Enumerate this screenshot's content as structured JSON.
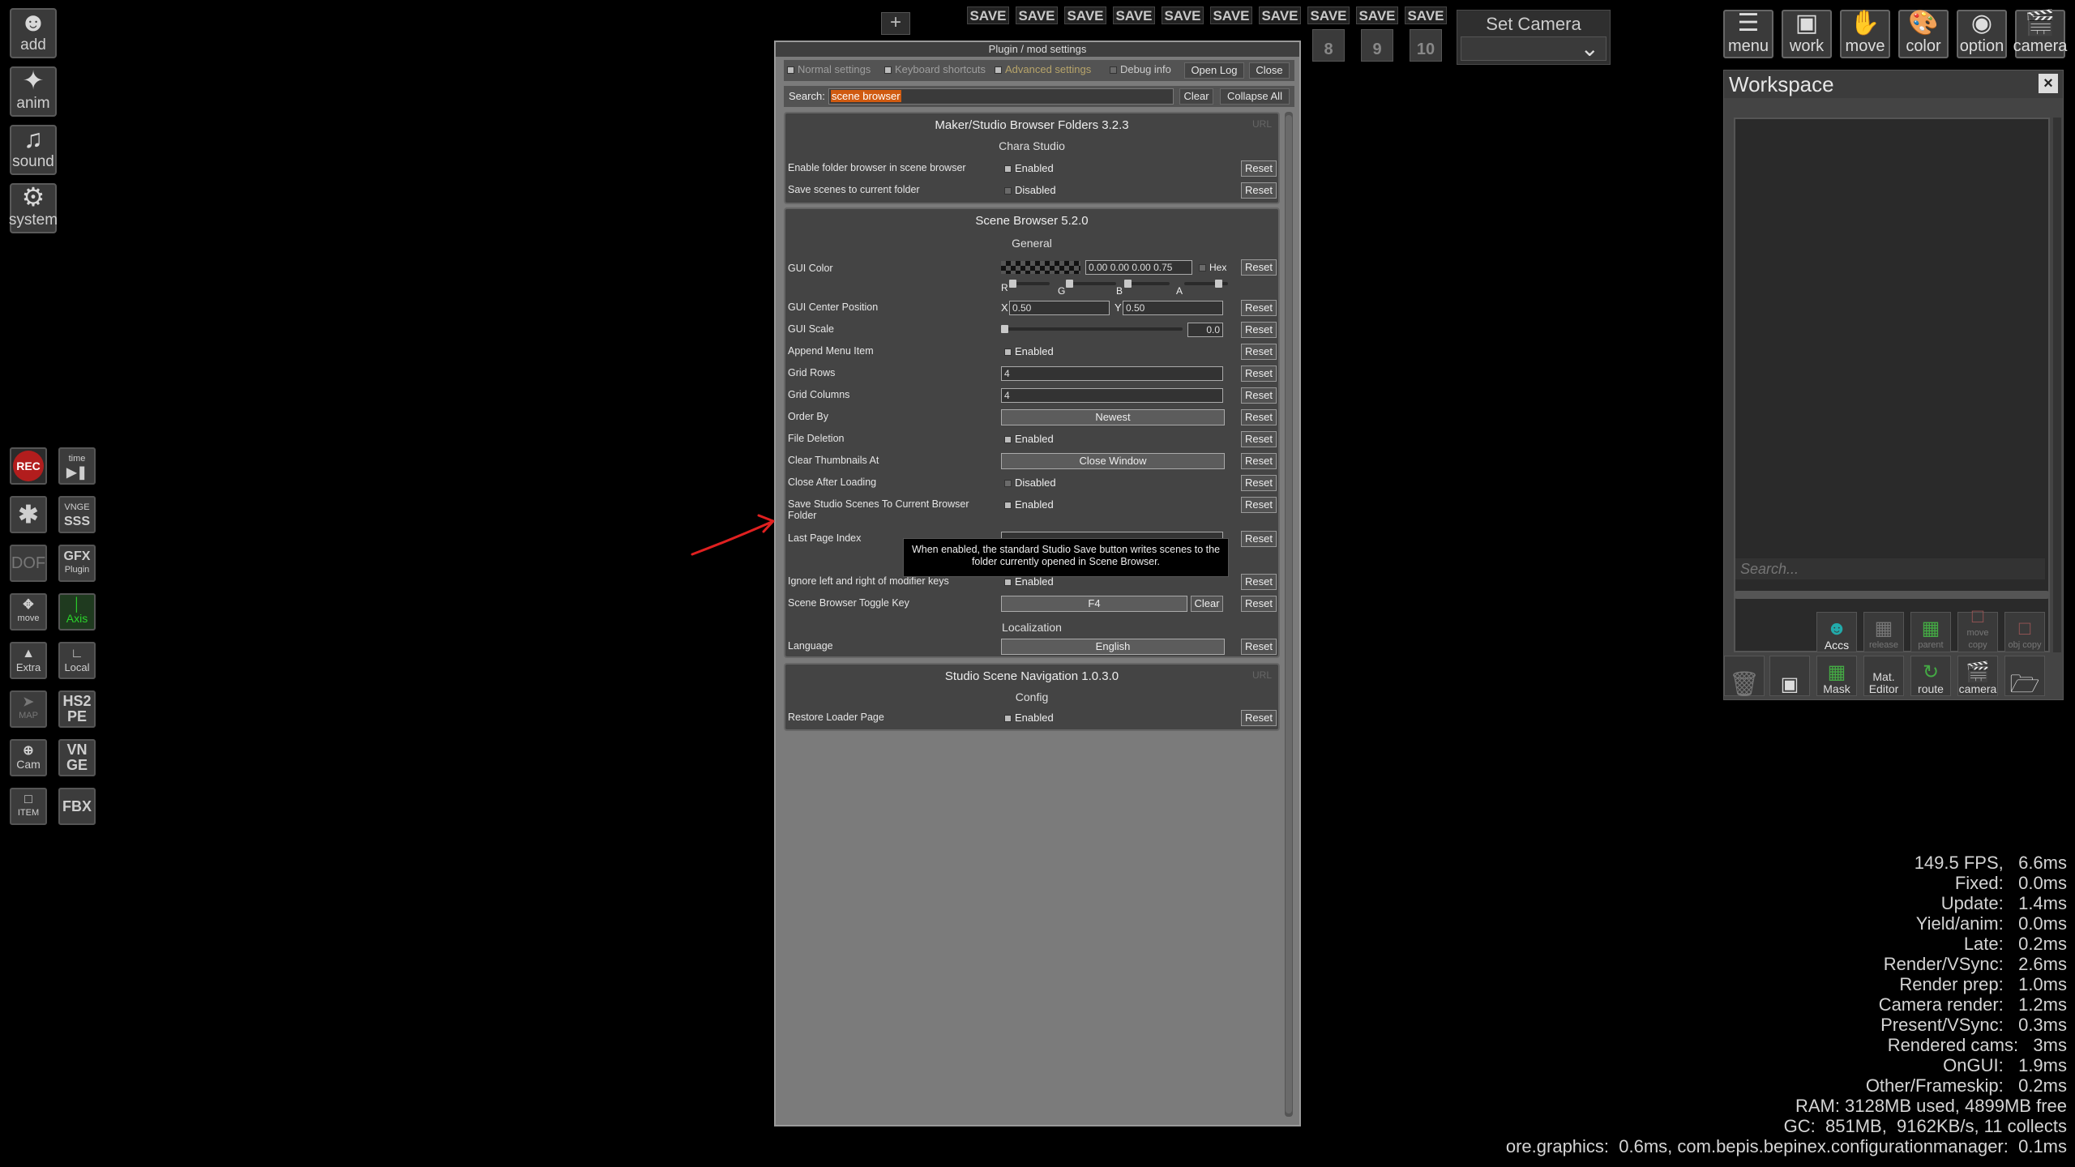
{
  "left_toolbar": [
    {
      "name": "add",
      "label": "add",
      "icon": "person-icon"
    },
    {
      "name": "anim",
      "label": "anim",
      "icon": "running-figure-icon"
    },
    {
      "name": "sound",
      "label": "sound",
      "icon": "music-note-icon"
    },
    {
      "name": "system",
      "label": "system",
      "icon": "gears-icon"
    }
  ],
  "left_small": {
    "rec": "REC",
    "time": "time",
    "sss_top": "VNGE",
    "sss": "SSS",
    "dof": "DOF",
    "gfx": "GFX",
    "gfx_sub": "Plugin",
    "move": "move",
    "axis": "Axis",
    "extra": "Extra",
    "local": "Local",
    "map": "MAP",
    "hs2pe": "HS2 PE",
    "cam": "Cam",
    "vnge": "VN GE",
    "item": "ITEM",
    "fbx": "FBX"
  },
  "save_bar": {
    "plus": "+",
    "slots": [
      {
        "label": "SAVE",
        "num": ""
      },
      {
        "label": "SAVE",
        "num": ""
      },
      {
        "label": "SAVE",
        "num": ""
      },
      {
        "label": "SAVE",
        "num": ""
      },
      {
        "label": "SAVE",
        "num": ""
      },
      {
        "label": "SAVE",
        "num": ""
      },
      {
        "label": "SAVE",
        "num": ""
      },
      {
        "label": "SAVE",
        "num": "8"
      },
      {
        "label": "SAVE",
        "num": "9"
      },
      {
        "label": "SAVE",
        "num": "10"
      }
    ],
    "set_camera": "Set Camera"
  },
  "right_menu": [
    {
      "label": "menu",
      "icon": "list-icon"
    },
    {
      "label": "work",
      "icon": "window-icon"
    },
    {
      "label": "move",
      "icon": "hand-icon"
    },
    {
      "label": "color",
      "icon": "palette-icon"
    },
    {
      "label": "option",
      "icon": "eye-icon"
    },
    {
      "label": "camera",
      "icon": "clapperboard-icon"
    }
  ],
  "workspace": {
    "title": "Workspace",
    "close": "×",
    "search_placeholder": "Search...",
    "buttons_row1": [
      "Accs",
      "release",
      "parent",
      "move copy",
      "obj copy"
    ],
    "buttons_row2": [
      "",
      "",
      "Mask",
      "Mat. Editor",
      "route",
      "camera",
      ""
    ]
  },
  "dialog": {
    "title": "Plugin / mod settings",
    "toolbar": {
      "normal": "Normal settings",
      "shortcuts": "Keyboard shortcuts",
      "advanced": "Advanced settings",
      "debug": "Debug info",
      "open_log": "Open Log",
      "close": "Close"
    },
    "search": {
      "label": "Search:",
      "value": "scene browser",
      "clear": "Clear",
      "collapse": "Collapse All"
    },
    "reset_label": "Reset",
    "sections": {
      "s1": {
        "title": "Maker/Studio Browser Folders 3.2.3",
        "url": "URL",
        "category": "Chara Studio",
        "rows": [
          {
            "name": "Enable folder browser in scene browser",
            "value": "Enabled",
            "checked": true
          },
          {
            "name": "Save scenes to current folder",
            "value": "Disabled",
            "checked": false
          }
        ]
      },
      "s2": {
        "title": "Scene Browser 5.2.0",
        "category": "General",
        "gui_color": {
          "name": "GUI Color",
          "value": "0.00 0.00 0.00 0.75",
          "hex": "Hex",
          "channels": [
            "R",
            "G",
            "B",
            "A"
          ]
        },
        "gui_center": {
          "name": "GUI Center Position",
          "x_label": "X",
          "x": "0.50",
          "y_label": "Y",
          "y": "0.50"
        },
        "gui_scale": {
          "name": "GUI Scale",
          "value": "0.0"
        },
        "append_menu": {
          "name": "Append Menu Item",
          "value": "Enabled"
        },
        "grid_rows": {
          "name": "Grid Rows",
          "value": "4"
        },
        "grid_columns": {
          "name": "Grid Columns",
          "value": "4"
        },
        "order_by": {
          "name": "Order By",
          "value": "Newest"
        },
        "file_deletion": {
          "name": "File Deletion",
          "value": "Enabled"
        },
        "clear_thumbs": {
          "name": "Clear Thumbnails At",
          "value": "Close Window"
        },
        "close_after": {
          "name": "Close After Loading",
          "value": "Disabled"
        },
        "save_studio": {
          "name": "Save Studio Scenes To Current Browser Folder",
          "value": "Enabled"
        },
        "last_page": {
          "name": "Last Page Index"
        },
        "ignore_lr": {
          "name": "Ignore left and right of modifier keys",
          "value": "Enabled"
        },
        "toggle_key": {
          "name": "Scene Browser Toggle Key",
          "value": "F4",
          "clear": "Clear"
        },
        "localization": "Localization",
        "language": {
          "name": "Language",
          "value": "English"
        }
      },
      "s3": {
        "title": "Studio Scene Navigation 1.0.3.0",
        "url": "URL",
        "category": "Config",
        "restore": {
          "name": "Restore Loader Page",
          "value": "Enabled"
        }
      }
    },
    "tooltip": "When enabled, the standard Studio Save button writes scenes to the folder currently opened in Scene Browser."
  },
  "stats": [
    "149.5 FPS,   6.6ms",
    "Fixed:   0.0ms",
    "Update:   1.4ms",
    "Yield/anim:   0.0ms",
    "Late:   0.2ms",
    "Render/VSync:   2.6ms",
    "Render prep:   1.0ms",
    "Camera render:   1.2ms",
    "Present/VSync:   0.3ms",
    "Rendered cams:   3ms",
    "OnGUI:   1.9ms",
    "Other/Frameskip:   0.2ms",
    "RAM: 3128MB used, 4899MB free",
    "GC:  851MB,  9162KB/s, 11 collects",
    "ore.graphics:  0.6ms, com.bepis.bepinex.configurationmanager:  0.1ms"
  ],
  "colors": {
    "accent_search_highlight": "#d05a10",
    "arrow": "#e02020",
    "rec": "#b21d1d",
    "axis": "#2bd42b"
  }
}
